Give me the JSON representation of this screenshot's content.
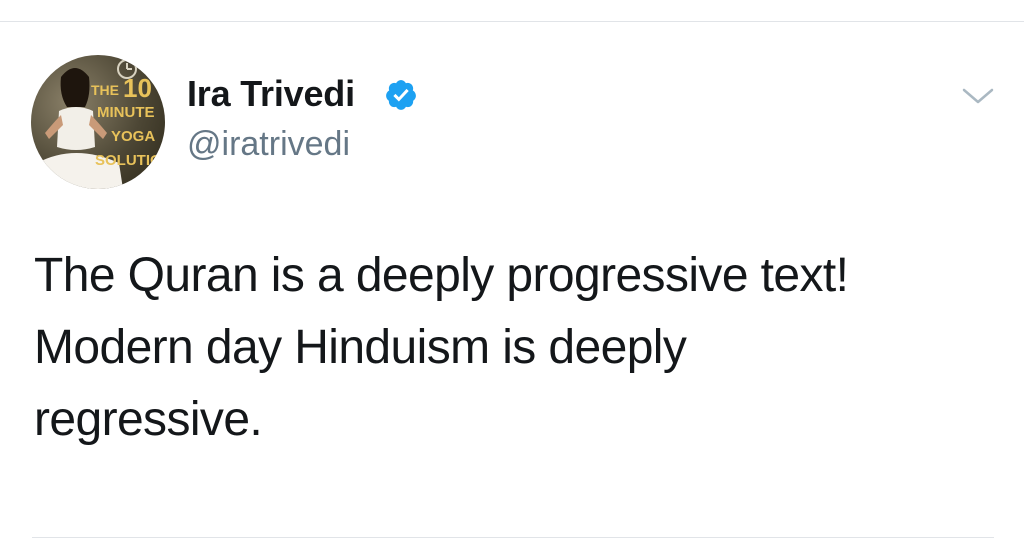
{
  "tweet": {
    "author": {
      "display_name": "Ira Trivedi",
      "handle": "@iratrivedi",
      "verified": true,
      "avatar": {
        "book_cover_text": [
          "THE",
          "10",
          "MINUTE",
          "YOGA",
          "SOLUTION"
        ]
      }
    },
    "text_lines": [
      "The Quran is a deeply progressive text!",
      "Modern day Hinduism is deeply",
      "regressive."
    ]
  },
  "icons": {
    "verified": "verified-badge-icon",
    "menu": "chevron-down-icon"
  },
  "colors": {
    "verified_blue": "#1da1f2",
    "text_primary": "#14171a",
    "text_secondary": "#657786",
    "divider": "#e1e4e8",
    "cover_title_gold": "#e8c25a"
  }
}
